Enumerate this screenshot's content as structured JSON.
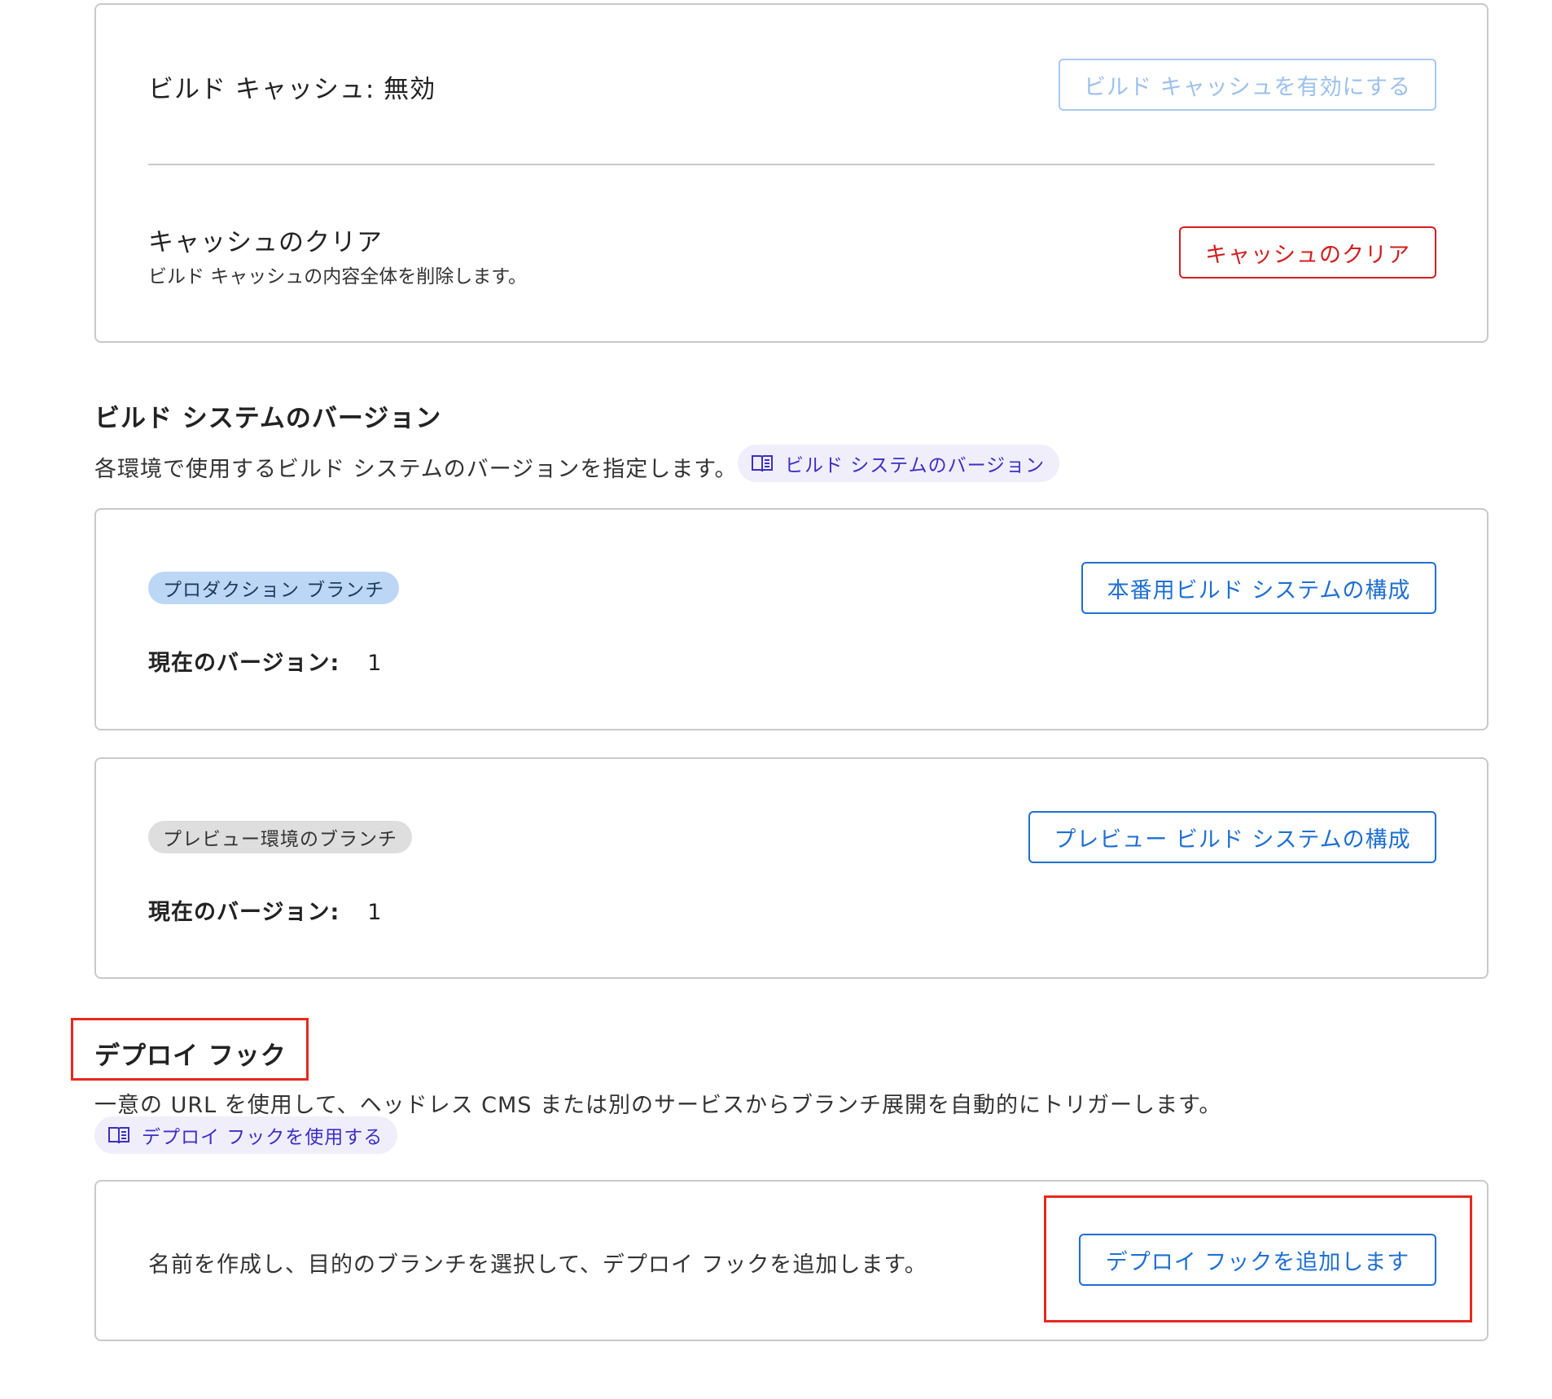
{
  "build_cache": {
    "status_label": "ビルド キャッシュ: 無効",
    "enable_button": "ビルド キャッシュを有効にする",
    "clear_title": "キャッシュのクリア",
    "clear_description": "ビルド キャッシュの内容全体を削除します。",
    "clear_button": "キャッシュのクリア"
  },
  "build_system": {
    "heading": "ビルド システムのバージョン",
    "description": "各環境で使用するビルド システムのバージョンを指定します。",
    "doc_link": "ビルド システムのバージョン",
    "production": {
      "badge": "プロダクション ブランチ",
      "configure_button": "本番用ビルド システムの構成",
      "version_label": "現在のバージョン:",
      "version_value": "1"
    },
    "preview": {
      "badge": "プレビュー環境のブランチ",
      "configure_button": "プレビュー ビルド システムの構成",
      "version_label": "現在のバージョン:",
      "version_value": "1"
    }
  },
  "deploy_hooks": {
    "heading": "デプロイ フック",
    "description": "一意の URL を使用して、ヘッドレス CMS または別のサービスからブランチ展開を自動的にトリガーします。",
    "doc_link": "デプロイ フックを使用する",
    "instruction": "名前を作成し、目的のブランチを選択して、デプロイ フックを追加します。",
    "add_button": "デプロイ フックを追加します"
  },
  "colors": {
    "primary_blue": "#1f6fd1",
    "danger_red": "#d11f1f",
    "highlight_red": "#e8281e",
    "doc_link_text": "#3b2fc4",
    "doc_link_bg": "#f0eefb",
    "card_border": "#c9c9c9"
  },
  "icons": {
    "doc_link": "book-icon"
  }
}
